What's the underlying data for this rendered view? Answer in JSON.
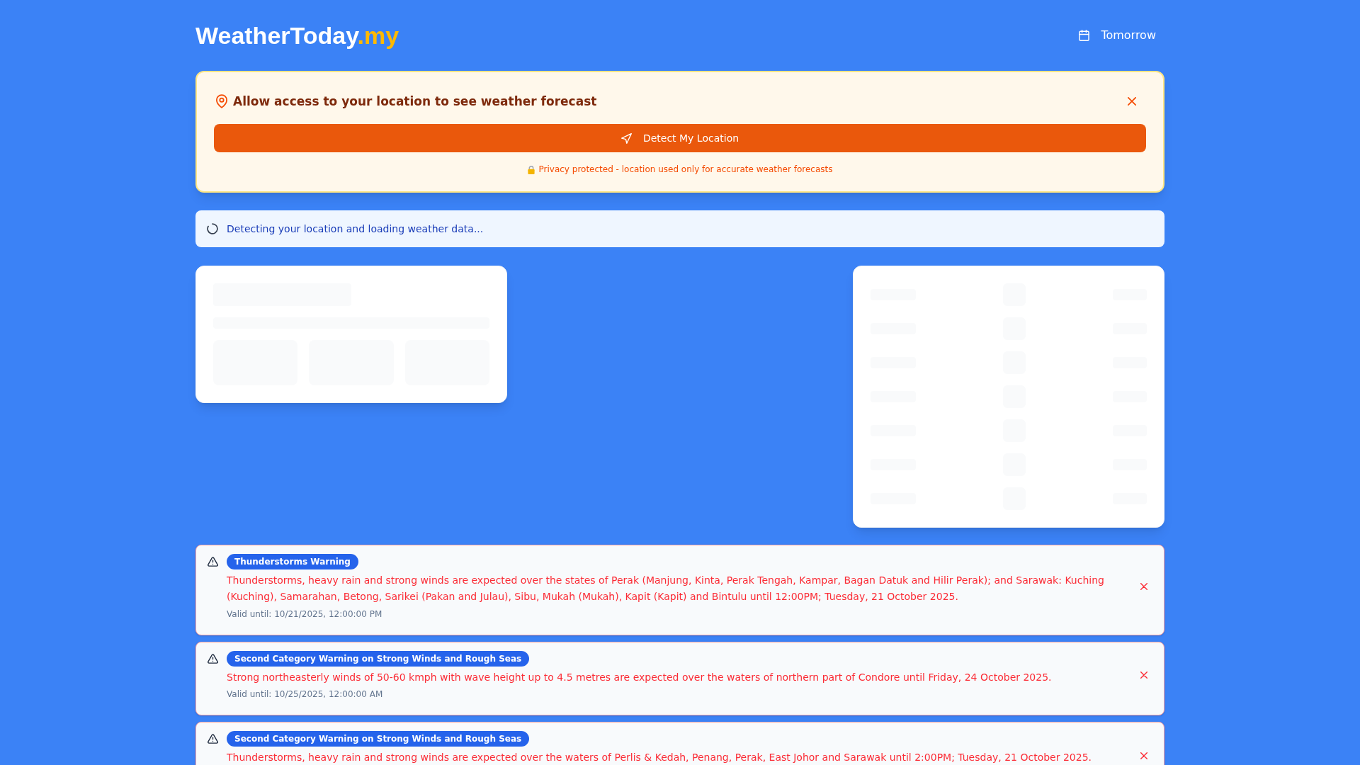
{
  "header": {
    "logo": {
      "text": "WeatherToday",
      "suffix": ".my"
    },
    "day_button": {
      "label": "Tomorrow"
    }
  },
  "location_prompt": {
    "title": "Allow access to your location to see weather forecast",
    "button": "Detect My Location",
    "note": "Privacy protected - location used only for accurate weather forecasts"
  },
  "loading": {
    "message": "Detecting your location and loading weather data..."
  },
  "warnings": [
    {
      "title": "Thunderstorms Warning",
      "description": "Thunderstorms, heavy rain and strong winds are expected over the states of Perak (Manjung, Kinta, Perak Tengah, Kampar, Bagan Datuk and Hilir Perak); and Sarawak: Kuching (Kuching), Samarahan, Betong, Sarikei (Pakan and Julau), Sibu, Mukah (Mukah), Kapit (Kapit) and Bintulu until 12:00PM; Tuesday, 21 October 2025.",
      "valid_until": "Valid until: 10/21/2025, 12:00:00 PM"
    },
    {
      "title": "Second Category Warning on Strong Winds and Rough Seas",
      "description": "Strong northeasterly winds of 50-60 kmph with wave height up to 4.5 metres are expected over the waters of northern part of Condore until Friday, 24 October 2025.",
      "valid_until": "Valid until: 10/25/2025, 12:00:00 AM"
    },
    {
      "title": "Second Category Warning on Strong Winds and Rough Seas",
      "description": "Thunderstorms, heavy rain and strong winds are expected over the waters of Perlis & Kedah, Penang, Perak, East Johor and Sarawak until 2:00PM; Tuesday, 21 October 2025."
    }
  ]
}
